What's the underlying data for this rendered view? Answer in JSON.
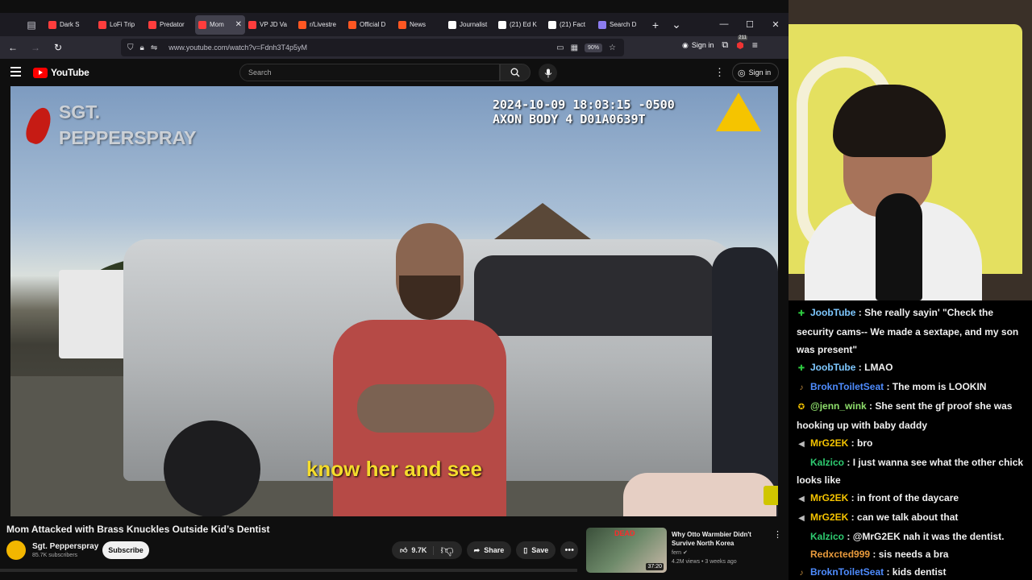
{
  "browser": {
    "tabs": [
      {
        "label": "Dark S",
        "fav": "#ff3d3d",
        "active": false
      },
      {
        "label": "LoFi Trip",
        "fav": "#ff3d3d",
        "active": false
      },
      {
        "label": "Predator",
        "fav": "#ff3d3d",
        "active": false
      },
      {
        "label": "Mom",
        "fav": "#ff3d3d",
        "active": true
      },
      {
        "label": "VP JD Va",
        "fav": "#ff3d3d",
        "active": false
      },
      {
        "label": "r/Livestre",
        "fav": "#ff5722",
        "active": false
      },
      {
        "label": "Official D",
        "fav": "#ff5722",
        "active": false
      },
      {
        "label": "News",
        "fav": "#ff5722",
        "active": false
      },
      {
        "label": "Journalist",
        "fav": "#ffffff",
        "active": false
      },
      {
        "label": "(21) Ed K",
        "fav": "#ffffff",
        "active": false
      },
      {
        "label": "(21) Fact",
        "fav": "#ffffff",
        "active": false
      },
      {
        "label": "Search D",
        "fav": "#8c7cf0",
        "active": false
      }
    ],
    "url": "www.youtube.com/watch?v=Fdnh3T4p5yM",
    "zoom": "90%",
    "signin_label": "Sign in",
    "notif_count": "211"
  },
  "youtube": {
    "logo_text": "YouTube",
    "search_placeholder": "Search",
    "signin_label": "Sign in"
  },
  "video": {
    "timestamp": "2024-10-09 18:03:15 -0500\nAXON BODY 4 D01A0639T",
    "watermark": "SGT.\nPEPPERSPRAY",
    "subtitle": "know her and see"
  },
  "info": {
    "title": "Mom Attacked with Brass Knuckles Outside Kid’s Dentist",
    "channel": "Sgt. Pepperspray",
    "subscribers": "85.7K subscribers",
    "subscribe_label": "Subscribe",
    "likes": "9.7K",
    "share_label": "Share",
    "save_label": "Save"
  },
  "recommendation": {
    "title": "Why Otto Warmbier Didn't Survive North Korea",
    "channel": "fern",
    "meta": "4.2M views • 3 weeks ago",
    "duration": "37:20",
    "thumb_text": "DEAD"
  },
  "chat": [
    {
      "badge": "✚",
      "badge_color": "#2ecc40",
      "user": "JoobTube",
      "color": "#7ec8ff",
      "text": "She really sayin' \"Check the security cams-- We made a sextape, and my son was present\""
    },
    {
      "badge": "✚",
      "badge_color": "#2ecc40",
      "user": "JoobTube",
      "color": "#7ec8ff",
      "text": "LMAO"
    },
    {
      "badge": "♪",
      "badge_color": "#c89040",
      "user": "BroknToiletSeat",
      "color": "#4e8cff",
      "text": "The mom is LOOKIN"
    },
    {
      "badge": "✪",
      "badge_color": "#f5c400",
      "user": "@jenn_wink",
      "color": "#8fe06c",
      "text": "She sent the gf proof she was hooking up with baby daddy"
    },
    {
      "badge": "◀",
      "badge_color": "#bbbbbb",
      "user": "MrG2EK",
      "color": "#f5c400",
      "text": "bro"
    },
    {
      "badge": "",
      "badge_color": "#000000",
      "user": "Kalzico",
      "color": "#2ecc71",
      "text": "I just wanna see what the other chick looks like"
    },
    {
      "badge": "◀",
      "badge_color": "#bbbbbb",
      "user": "MrG2EK",
      "color": "#f5c400",
      "text": "in front of the daycare"
    },
    {
      "badge": "◀",
      "badge_color": "#bbbbbb",
      "user": "MrG2EK",
      "color": "#f5c400",
      "text": "can we talk about that"
    },
    {
      "badge": "",
      "badge_color": "#000000",
      "user": "Kalzico",
      "color": "#2ecc71",
      "text": "@MrG2EK nah it was the dentist."
    },
    {
      "badge": "",
      "badge_color": "#000000",
      "user": "Redxcted999",
      "color": "#e89a3c",
      "text": "sis needs a bra"
    },
    {
      "badge": "♪",
      "badge_color": "#c89040",
      "user": "BroknToiletSeat",
      "color": "#4e8cff",
      "text": "kids dentist"
    }
  ]
}
